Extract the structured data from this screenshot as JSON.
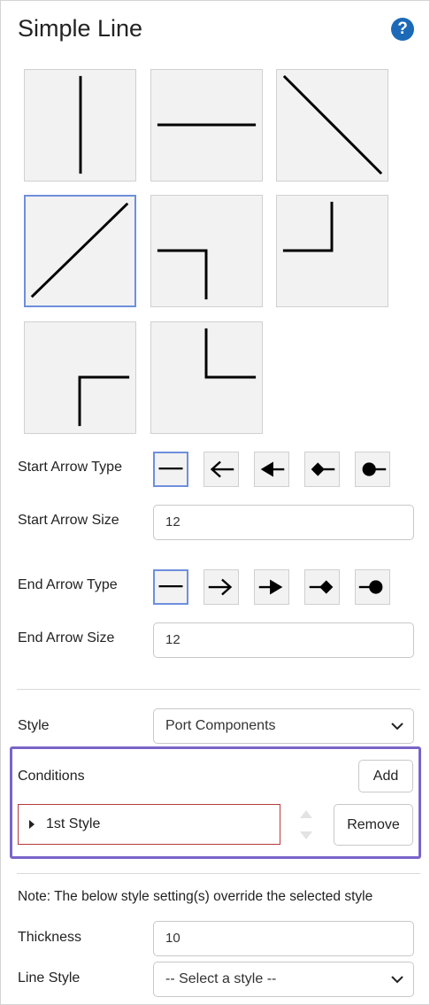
{
  "panel": {
    "title": "Simple Line",
    "help_icon": "question-circle-icon",
    "help_glyph": "?",
    "accent": "#1c69b8",
    "selected_border": "#6e8fdc"
  },
  "shapes": [
    {
      "name": "vertical-line",
      "selected": false
    },
    {
      "name": "horizontal-line",
      "selected": false
    },
    {
      "name": "diagonal-down-line",
      "selected": false
    },
    {
      "name": "diagonal-up-line",
      "selected": true
    },
    {
      "name": "elbow-right-down",
      "selected": false
    },
    {
      "name": "elbow-up-left",
      "selected": false
    },
    {
      "name": "elbow-up-right",
      "selected": false
    },
    {
      "name": "elbow-down-right",
      "selected": false
    }
  ],
  "start_arrow": {
    "type_label": "Start Arrow Type",
    "size_label": "Start Arrow Size",
    "size_value": "12",
    "types": [
      "none",
      "open-arrow-left",
      "filled-arrow-left",
      "diamond",
      "circle"
    ],
    "selected_index": 0
  },
  "end_arrow": {
    "type_label": "End Arrow Type",
    "size_label": "End Arrow Size",
    "size_value": "12",
    "types": [
      "none",
      "open-arrow-right",
      "filled-arrow-right",
      "diamond",
      "circle"
    ],
    "selected_index": 0
  },
  "style": {
    "label": "Style",
    "selected": "Port Components"
  },
  "conditions": {
    "label": "Conditions",
    "add_label": "Add",
    "remove_label": "Remove",
    "items": [
      {
        "label": "1st Style"
      }
    ],
    "highlight_color": "#7a64c9"
  },
  "overrides": {
    "note": "Note: The below style setting(s) override the selected style",
    "thickness_label": "Thickness",
    "thickness_value": "10",
    "line_style_label": "Line Style",
    "line_style_placeholder": "-- Select a style --"
  }
}
